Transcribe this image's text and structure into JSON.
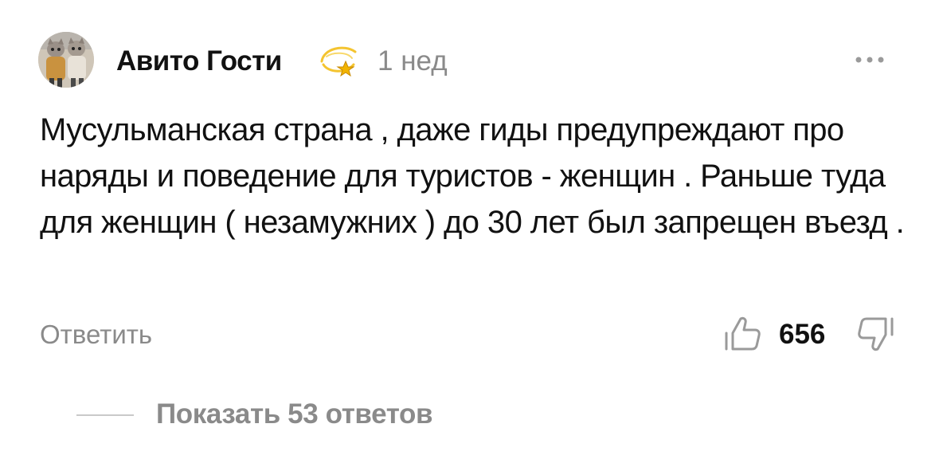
{
  "comment": {
    "author": "Авито Гости",
    "badge_icon": "dizzy-star-icon",
    "time": "1 нед",
    "more_icon": "more-dots-icon",
    "text": "Мусульманская страна , даже гиды предупреждают про наряды и поведение для туристов - женщин . Раньше туда для женщин ( незамужних ) до 30 лет был запрещен въезд .",
    "reply_label": "Ответить",
    "like_icon": "thumbs-up-icon",
    "like_count": "656",
    "dislike_icon": "thumbs-down-icon",
    "show_replies_label": "Показать 53 ответов"
  },
  "colors": {
    "text_primary": "#111111",
    "text_secondary": "#8a8a8a",
    "divider": "#c9c9c9",
    "badge_gold": "#f2b400"
  }
}
